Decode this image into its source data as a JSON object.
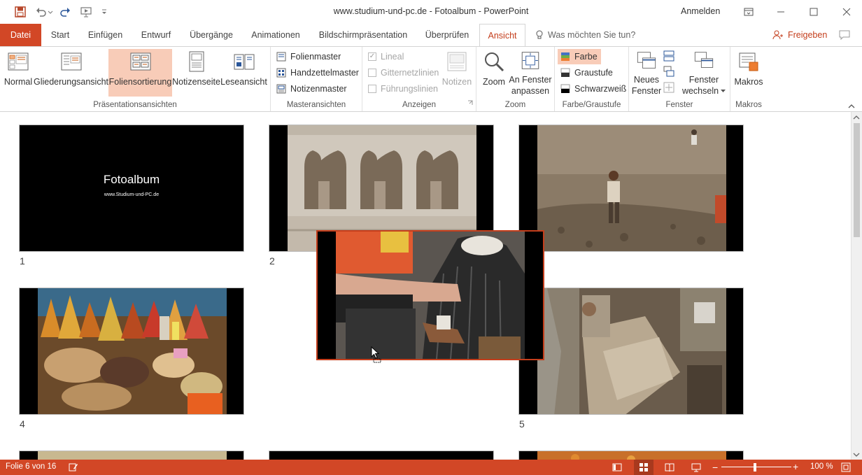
{
  "window": {
    "title": "www.studium-und-pc.de - Fotoalbum  -  PowerPoint",
    "sign_in": "Anmelden"
  },
  "tabs": [
    {
      "label": "Datei"
    },
    {
      "label": "Start"
    },
    {
      "label": "Einfügen"
    },
    {
      "label": "Entwurf"
    },
    {
      "label": "Übergänge"
    },
    {
      "label": "Animationen"
    },
    {
      "label": "Bildschirmpräsentation"
    },
    {
      "label": "Überprüfen"
    },
    {
      "label": "Ansicht"
    }
  ],
  "tell_me": "Was möchten Sie tun?",
  "share": "Freigeben",
  "ribbon": {
    "presentation_views": {
      "label": "Präsentationsansichten",
      "buttons": [
        "Normal",
        "Gliederungsansicht",
        "Foliensortierung",
        "Notizenseite",
        "Leseansicht"
      ]
    },
    "master_views": {
      "label": "Masteransichten",
      "buttons": [
        "Folienmaster",
        "Handzettelmaster",
        "Notizenmaster"
      ]
    },
    "show": {
      "label": "Anzeigen",
      "items": [
        "Lineal",
        "Gitternetzlinien",
        "Führungslinien"
      ],
      "notes": "Notizen"
    },
    "zoom": {
      "label": "Zoom",
      "zoom": "Zoom",
      "fit_line1": "An Fenster",
      "fit_line2": "anpassen"
    },
    "color": {
      "label": "Farbe/Graustufe",
      "items": [
        "Farbe",
        "Graustufe",
        "Schwarzweiß"
      ]
    },
    "window": {
      "label": "Fenster",
      "new_line1": "Neues",
      "new_line2": "Fenster",
      "switch_line1": "Fenster",
      "switch_line2": "wechseln"
    },
    "macros": {
      "label": "Makros",
      "macros": "Makros"
    }
  },
  "slides": {
    "slide1_title": "Fotoalbum",
    "slide1_subtitle": "www.Studium-und-PC.de",
    "numbers": [
      "1",
      "2",
      "4",
      "5"
    ]
  },
  "status": {
    "slide_info": "Folie 6 von 16",
    "zoom": "100 %",
    "accent": "#d24726"
  }
}
